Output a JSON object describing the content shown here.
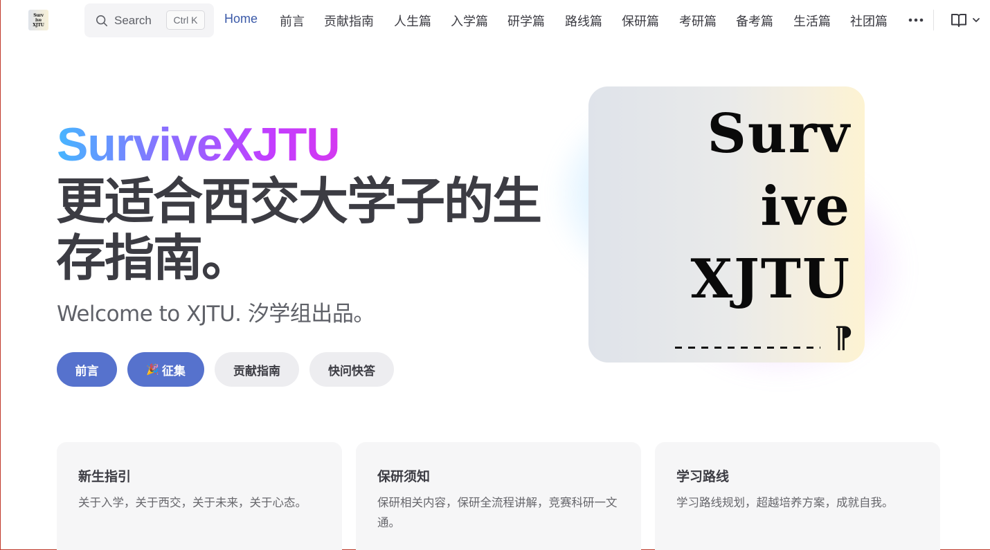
{
  "logo": {
    "lines": [
      "Surv",
      "ive",
      "XJTU"
    ]
  },
  "search": {
    "label": "Search",
    "shortcut": "Ctrl K",
    "icon": "search-icon"
  },
  "nav": {
    "items": [
      {
        "label": "Home",
        "active": true
      },
      {
        "label": "前言"
      },
      {
        "label": "贡献指南"
      },
      {
        "label": "人生篇"
      },
      {
        "label": "入学篇"
      },
      {
        "label": "研学篇"
      },
      {
        "label": "路线篇"
      },
      {
        "label": "保研篇"
      },
      {
        "label": "考研篇"
      },
      {
        "label": "备考篇"
      },
      {
        "label": "生活篇"
      },
      {
        "label": "社团篇"
      }
    ],
    "more_icon": "more-horizontal-icon",
    "book_icon": "book-open-icon",
    "chevron_icon": "chevron-down-icon",
    "active_color": "#3a59a8"
  },
  "hero": {
    "brand": "SurviveXJTU",
    "title": "更适合西交大学子的生存指南。",
    "tagline": "Welcome to XJTU. 汐学组出品。",
    "actions": [
      {
        "label": "前言",
        "theme": "brand"
      },
      {
        "label": "征集",
        "emoji": "🎉",
        "theme": "brand"
      },
      {
        "label": "贡献指南",
        "theme": "alt"
      },
      {
        "label": "快问快答",
        "theme": "alt"
      }
    ],
    "image": {
      "lines": [
        "Surv",
        "ive",
        "XJTU"
      ],
      "mark": "⁋"
    },
    "brand_color": "#5672cd",
    "gradient": [
      "#46b6ff",
      "#8d6cff",
      "#c23dff"
    ]
  },
  "features": [
    {
      "title": "新生指引",
      "details": "关于入学，关于西交，关于未来，关于心态。"
    },
    {
      "title": "保研须知",
      "details": "保研相关内容，保研全流程讲解，竞赛科研一文通。"
    },
    {
      "title": "学习路线",
      "details": "学习路线规划，超越培养方案，成就自我。"
    }
  ]
}
